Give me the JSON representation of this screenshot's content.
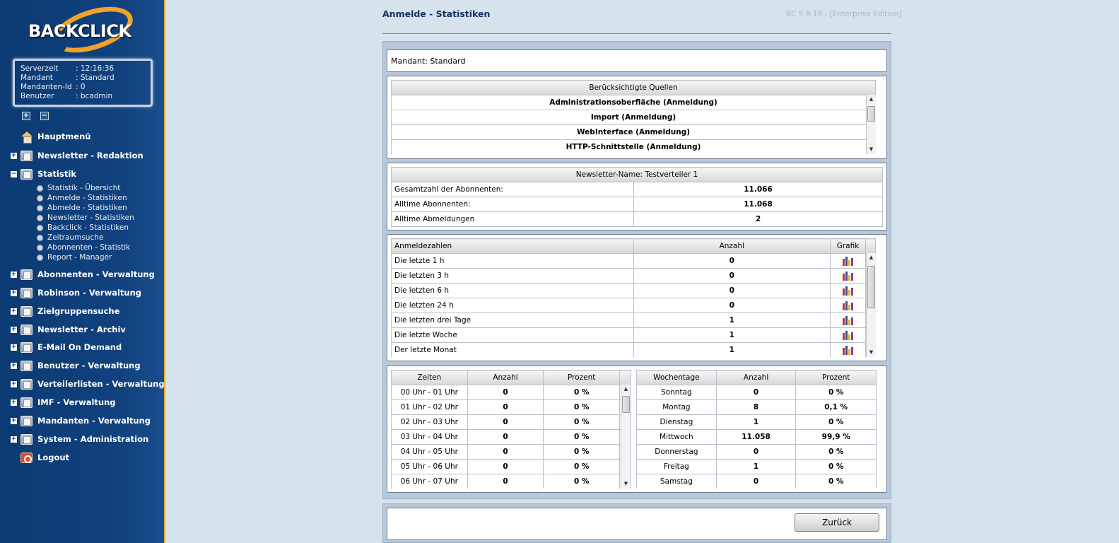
{
  "logo": {
    "text": "BACKCLICK"
  },
  "server_info": [
    {
      "key": "Serverzeit",
      "value": ": 12:16:36"
    },
    {
      "key": "Mandant",
      "value": ": Standard"
    },
    {
      "key": "Mandanten-Id",
      "value": ": 0"
    },
    {
      "key": "Benutzer",
      "value": ": bcadmin"
    }
  ],
  "tree_controls": {
    "expand": "+",
    "collapse": "−"
  },
  "nav": {
    "hauptmenue": "Hauptmenü",
    "newsletter_redaktion": "Newsletter - Redaktion",
    "statistik": "Statistik",
    "statistik_sub": [
      "Statistik - Übersicht",
      "Anmelde - Statistiken",
      "Abmelde - Statistiken",
      "Newsletter - Statistiken",
      "Backclick - Statistiken",
      "Zeitraumsuche",
      "Abonnenten - Statistik",
      "Report - Manager"
    ],
    "abonnenten": "Abonnenten - Verwaltung",
    "robinson": "Robinson - Verwaltung",
    "zielgruppensuche": "Zielgruppensuche",
    "archiv": "Newsletter - Archiv",
    "email_on_demand": "E-Mail On Demand",
    "benutzer": "Benutzer - Verwaltung",
    "verteilerlisten": "Verteilerlisten - Verwaltung",
    "imf": "IMF - Verwaltung",
    "mandanten": "Mandanten - Verwaltung",
    "system": "System - Administration",
    "logout": "Logout"
  },
  "page": {
    "title": "Anmelde - Statistiken",
    "version": "BC 5.9.10 - [Enterprise Edition]",
    "mandant": "Mandant: Standard"
  },
  "sources": {
    "header": "Berücksichtigte Quellen",
    "items": [
      "Administrationsoberfläche (Anmeldung)",
      "Import (Anmeldung)",
      "WebInterface (Anmeldung)",
      "HTTP-Schnittstelle (Anmeldung)"
    ]
  },
  "newsletter": {
    "header": "Newsletter-Name:  Testverteiler 1",
    "rows": [
      {
        "label": "Gesamtzahl der Abonnenten:",
        "value": "11.066"
      },
      {
        "label": "Alltime Abonnenten:",
        "value": "11.068"
      },
      {
        "label": "Alltime Abmeldungen",
        "value": "2"
      }
    ]
  },
  "anmeldezahlen": {
    "headers": [
      "Anmeldezahlen",
      "Anzahl",
      "Grafik"
    ],
    "rows": [
      {
        "label": "Die letzte 1 h",
        "value": "0"
      },
      {
        "label": "Die letzten 3 h",
        "value": "0"
      },
      {
        "label": "Die letzten 6 h",
        "value": "0"
      },
      {
        "label": "Die letzten 24 h",
        "value": "0"
      },
      {
        "label": "Die letzten drei Tage",
        "value": "1"
      },
      {
        "label": "Die letzte Woche",
        "value": "1"
      },
      {
        "label": "Der letzte Monat",
        "value": "1"
      }
    ]
  },
  "zeiten": {
    "headers": [
      "Zeiten",
      "Anzahl",
      "Prozent"
    ],
    "rows": [
      [
        "00 Uhr - 01 Uhr",
        "0",
        "0 %"
      ],
      [
        "01 Uhr - 02 Uhr",
        "0",
        "0 %"
      ],
      [
        "02 Uhr - 03 Uhr",
        "0",
        "0 %"
      ],
      [
        "03 Uhr - 04 Uhr",
        "0",
        "0 %"
      ],
      [
        "04 Uhr - 05 Uhr",
        "0",
        "0 %"
      ],
      [
        "05 Uhr - 06 Uhr",
        "0",
        "0 %"
      ],
      [
        "06 Uhr - 07 Uhr",
        "0",
        "0 %"
      ]
    ]
  },
  "wochentage": {
    "headers": [
      "Wochentage",
      "Anzahl",
      "Prozent"
    ],
    "rows": [
      [
        "Sonntag",
        "0",
        "0 %"
      ],
      [
        "Montag",
        "8",
        "0,1 %"
      ],
      [
        "Dienstag",
        "1",
        "0 %"
      ],
      [
        "Mittwoch",
        "11.058",
        "99,9 %"
      ],
      [
        "Donnerstag",
        "0",
        "0 %"
      ],
      [
        "Freitag",
        "1",
        "0 %"
      ],
      [
        "Samstag",
        "0",
        "0 %"
      ]
    ]
  },
  "footer": {
    "back_label": "Zurück"
  },
  "colors": {
    "sidebar": "#11427f",
    "accent": "#f2a22a",
    "title": "#10305e"
  }
}
